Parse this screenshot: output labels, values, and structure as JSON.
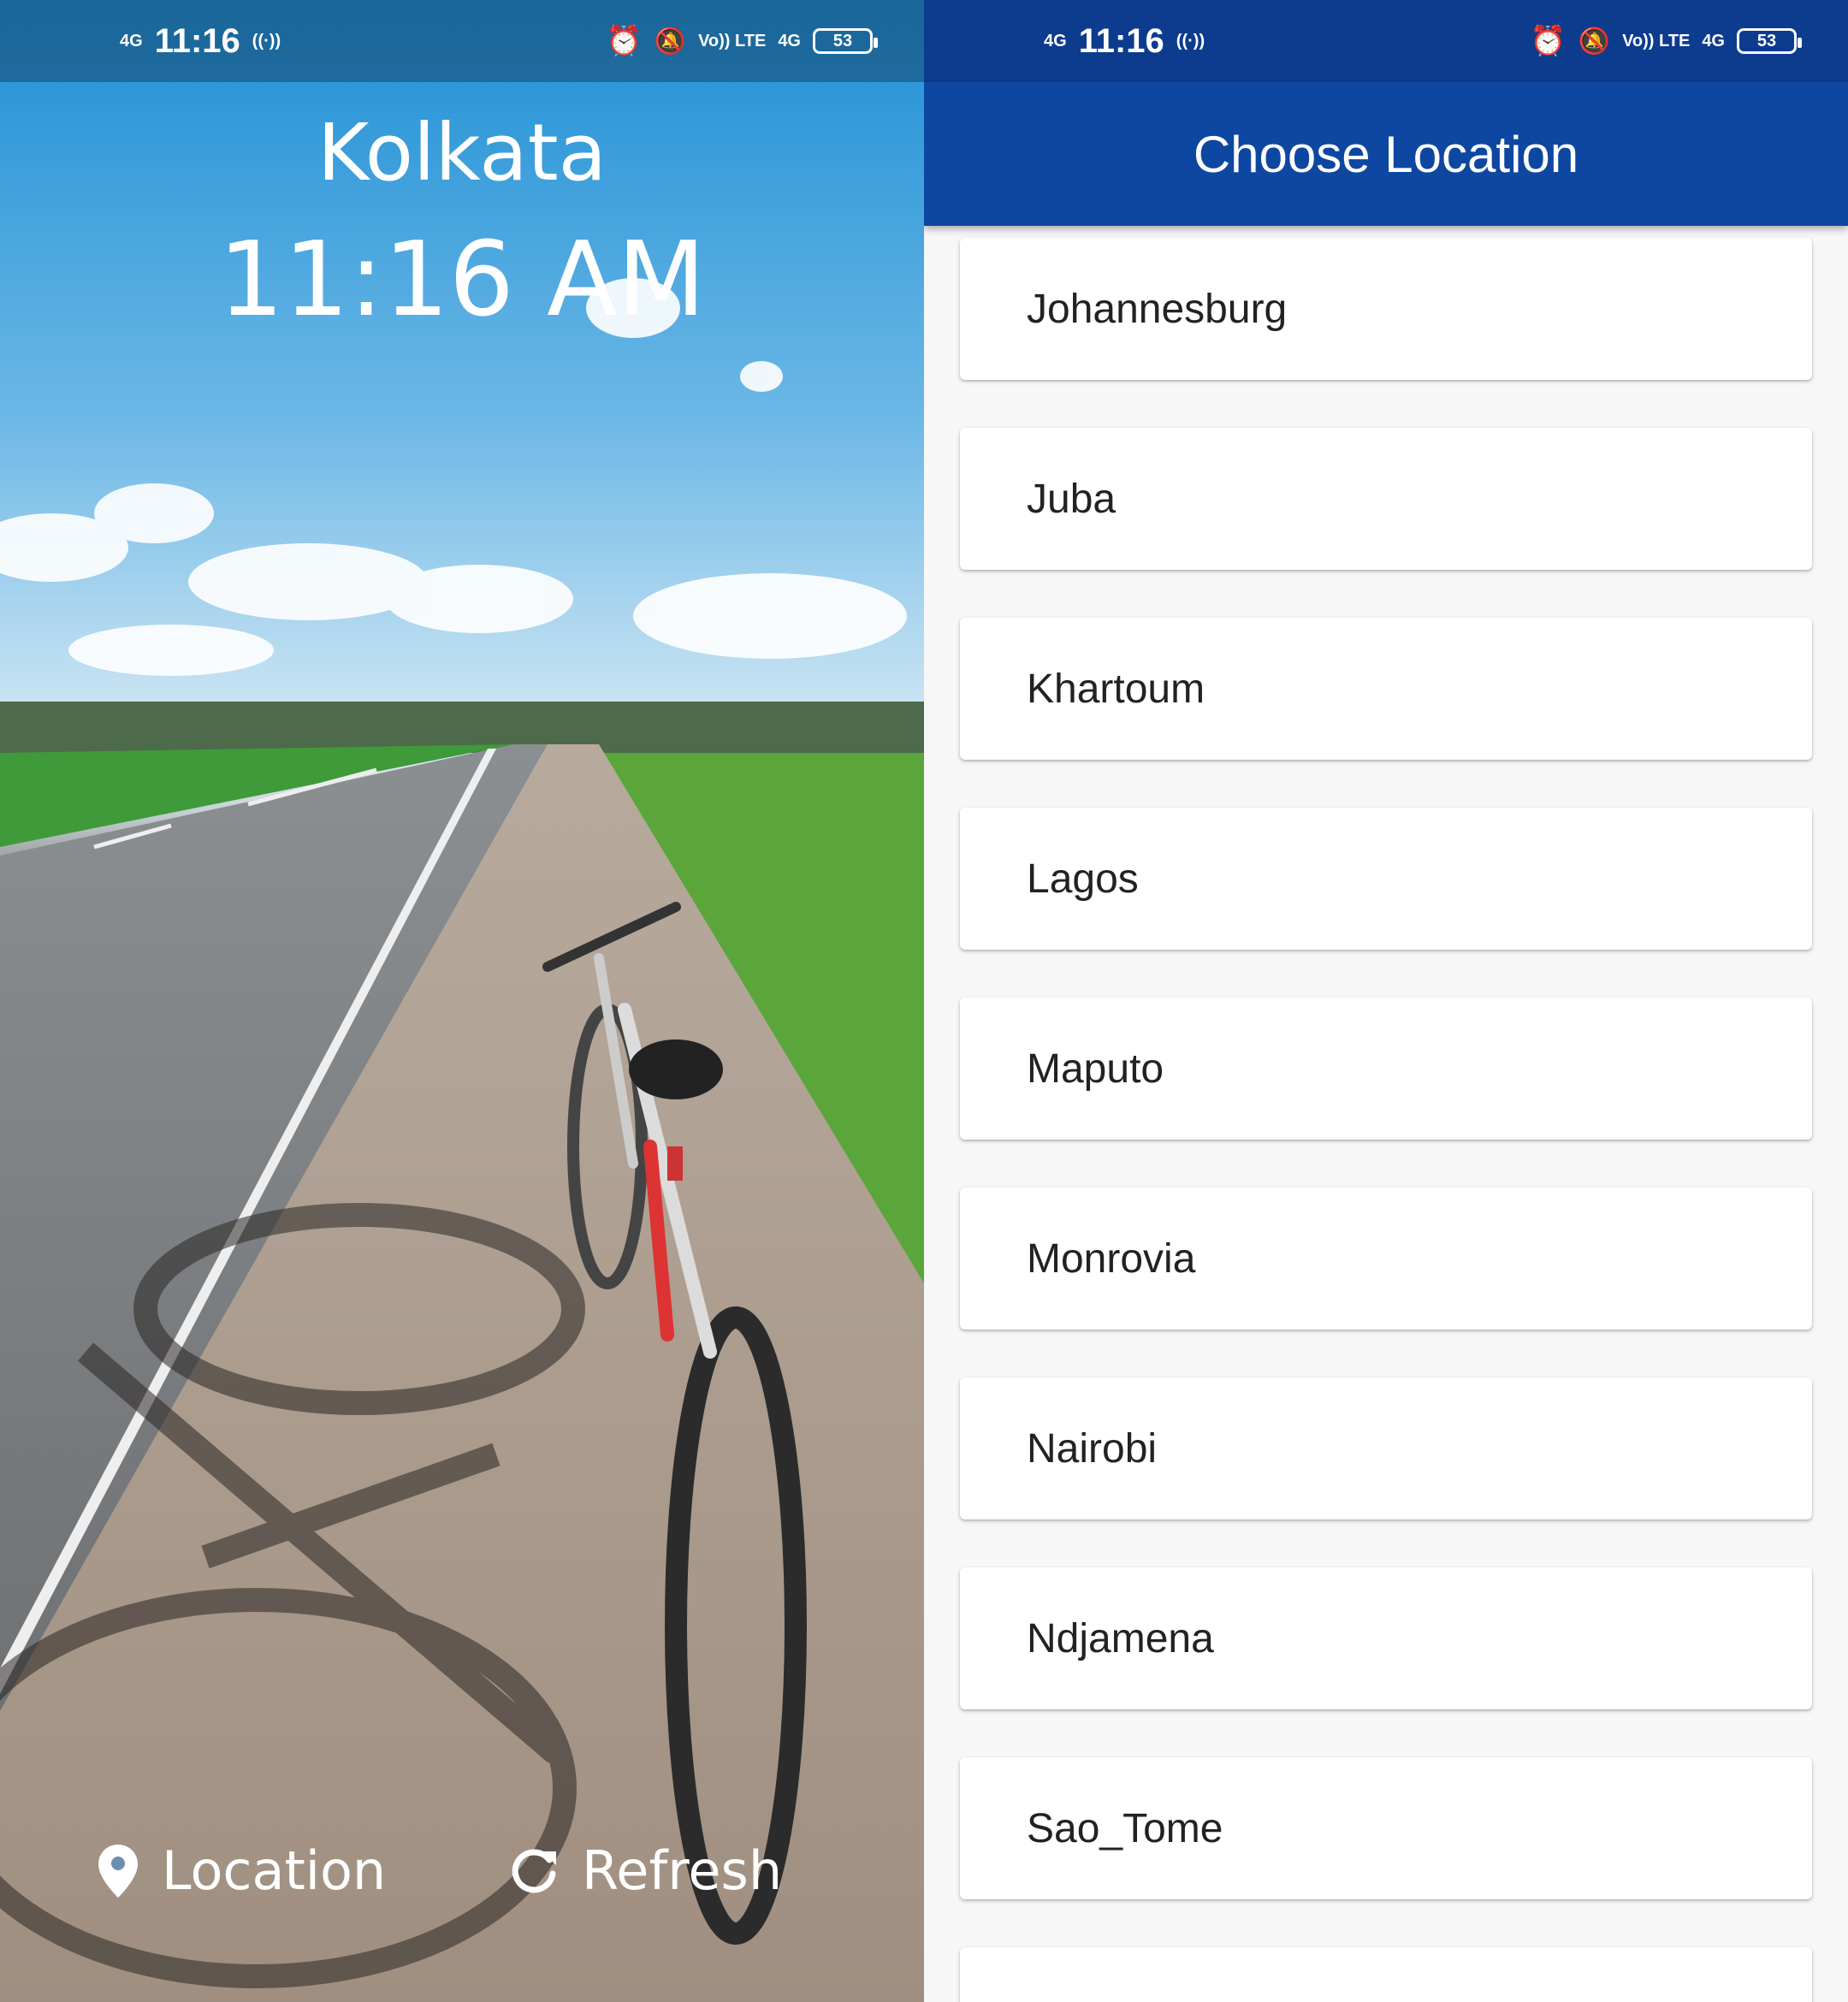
{
  "status_bar": {
    "network": "4G",
    "time": "11:16",
    "volte": "Vo)) LTE",
    "battery": "53"
  },
  "home": {
    "city": "Kolkata",
    "time": "11:16 AM",
    "location_label": "Location",
    "refresh_label": "Refresh"
  },
  "chooser": {
    "title": "Choose Location",
    "locations": [
      "Johannesburg",
      "Juba",
      "Khartoum",
      "Lagos",
      "Maputo",
      "Monrovia",
      "Nairobi",
      "Ndjamena",
      "Sao_Tome"
    ]
  },
  "colors": {
    "app_bar": "#0d47a1",
    "status_bar_right": "#0d3b8e",
    "list_background": "#f7f7f7"
  }
}
